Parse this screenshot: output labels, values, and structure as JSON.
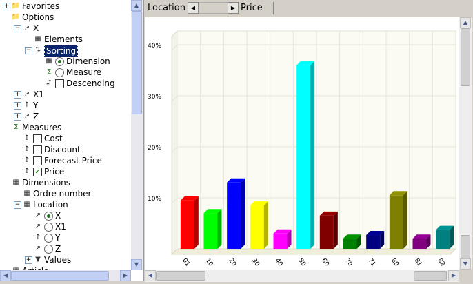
{
  "tree": {
    "items": [
      {
        "label": "Favorites",
        "icon": "folder-icon",
        "expander": "+"
      },
      {
        "label": "Options",
        "icon": "folder-icon",
        "expander": ""
      },
      {
        "label": "X",
        "icon": "axis-x-icon",
        "expander": "−"
      },
      {
        "label": "Elements",
        "icon": "elements-icon",
        "expander": ""
      },
      {
        "label": "Sorting",
        "icon": "sort-icon",
        "expander": "−"
      },
      {
        "label": "Dimension",
        "icon": "dimension-icon",
        "control": "radio-on"
      },
      {
        "label": "Measure",
        "icon": "sigma-icon",
        "control": "radio-off"
      },
      {
        "label": "Descending",
        "icon": "sort-desc-icon",
        "control": "checkbox-off"
      },
      {
        "label": "X1",
        "icon": "axis-x1-icon",
        "expander": "+"
      },
      {
        "label": "Y",
        "icon": "axis-y-icon",
        "expander": "+"
      },
      {
        "label": "Z",
        "icon": "axis-z-icon",
        "expander": "+"
      },
      {
        "label": "Measures",
        "icon": "sigma-icon",
        "expander": ""
      },
      {
        "label": "Cost",
        "icon": "measure-icon",
        "control": "checkbox-off"
      },
      {
        "label": "Discount",
        "icon": "measure-icon",
        "control": "checkbox-off"
      },
      {
        "label": "Forecast Price",
        "icon": "measure-icon",
        "control": "checkbox-off"
      },
      {
        "label": "Price",
        "icon": "measure-icon",
        "control": "checkbox-on"
      },
      {
        "label": "Dimensions",
        "icon": "dimension-icon",
        "expander": ""
      },
      {
        "label": "Ordre number",
        "icon": "dimension-icon",
        "expander": ""
      },
      {
        "label": "Location",
        "icon": "dimension-icon",
        "expander": "−"
      },
      {
        "label": "X",
        "icon": "axis-x-icon",
        "control": "radio-on"
      },
      {
        "label": "X1",
        "icon": "axis-x1-icon",
        "control": "radio-off"
      },
      {
        "label": "Y",
        "icon": "axis-y-icon",
        "control": "radio-off"
      },
      {
        "label": "Z",
        "icon": "axis-z-icon",
        "control": "radio-off"
      },
      {
        "label": "Values",
        "icon": "filter-icon",
        "expander": "+"
      },
      {
        "label": "Article",
        "icon": "dimension-icon",
        "expander": ""
      }
    ]
  },
  "toolbar": {
    "location_label": "Location",
    "price_label": "Price"
  },
  "chart_data": {
    "type": "bar",
    "categories": [
      "01",
      "10",
      "20",
      "30",
      "40",
      "50",
      "60",
      "70",
      "71",
      "80",
      "81",
      "82"
    ],
    "values": [
      9.5,
      7,
      13,
      8.5,
      3,
      36,
      6.5,
      2,
      2.7,
      10.5,
      2,
      3.7
    ],
    "colors": [
      "#ff0000",
      "#00ff00",
      "#0000ff",
      "#ffff00",
      "#ff00ff",
      "#00ffff",
      "#800000",
      "#008000",
      "#000080",
      "#808000",
      "#800080",
      "#008080"
    ],
    "yticks": [
      "10%",
      "20%",
      "30%",
      "40%"
    ],
    "ylim": [
      0,
      40
    ],
    "grid": true
  }
}
